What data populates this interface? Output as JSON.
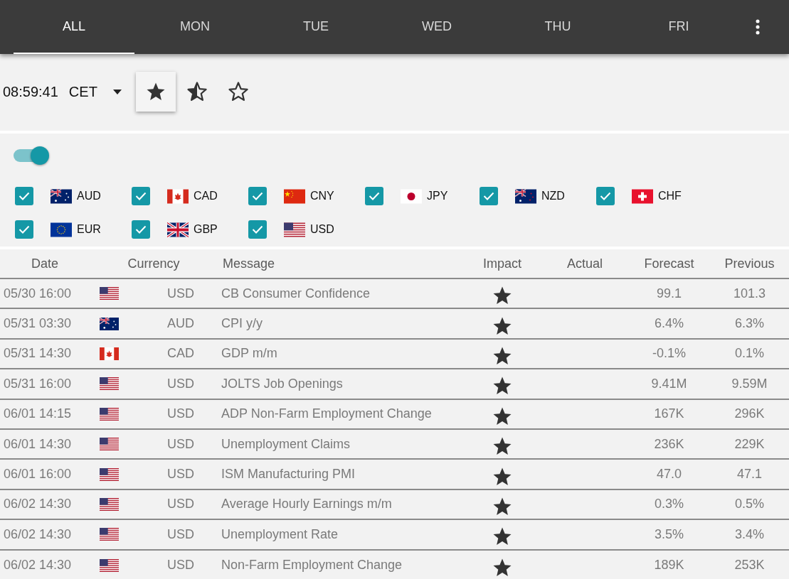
{
  "tabs": [
    {
      "label": "ALL",
      "selected": true
    },
    {
      "label": "MON",
      "selected": false
    },
    {
      "label": "TUE",
      "selected": false
    },
    {
      "label": "WED",
      "selected": false
    },
    {
      "label": "THU",
      "selected": false
    },
    {
      "label": "FRI",
      "selected": false
    }
  ],
  "clock": {
    "time": "08:59:41",
    "timezone": "CET"
  },
  "impact_filters": [
    {
      "kind": "full",
      "selected": true
    },
    {
      "kind": "half",
      "selected": false
    },
    {
      "kind": "empty",
      "selected": false
    }
  ],
  "toggle": {
    "on": true
  },
  "currencies": [
    {
      "code": "AUD",
      "kind": "au",
      "checked": true
    },
    {
      "code": "CAD",
      "kind": "ca",
      "checked": true
    },
    {
      "code": "CNY",
      "kind": "cn",
      "checked": true
    },
    {
      "code": "JPY",
      "kind": "jp",
      "checked": true
    },
    {
      "code": "NZD",
      "kind": "nz",
      "checked": true
    },
    {
      "code": "CHF",
      "kind": "ch",
      "checked": true
    },
    {
      "code": "EUR",
      "kind": "eu",
      "checked": true
    },
    {
      "code": "GBP",
      "kind": "gb",
      "checked": true
    },
    {
      "code": "USD",
      "kind": "us",
      "checked": true
    }
  ],
  "table": {
    "columns": [
      "Date",
      "Currency",
      "Message",
      "Impact",
      "Actual",
      "Forecast",
      "Previous"
    ],
    "rows": [
      {
        "date": "05/30 16:00",
        "kind": "us",
        "currency": "USD",
        "message": "CB Consumer Confidence",
        "forecast": "99.1",
        "previous": "101.3"
      },
      {
        "date": "05/31 03:30",
        "kind": "au",
        "currency": "AUD",
        "message": "CPI y/y",
        "forecast": "6.4%",
        "previous": "6.3%"
      },
      {
        "date": "05/31 14:30",
        "kind": "ca",
        "currency": "CAD",
        "message": "GDP m/m",
        "forecast": "-0.1%",
        "previous": "0.1%"
      },
      {
        "date": "05/31 16:00",
        "kind": "us",
        "currency": "USD",
        "message": "JOLTS Job Openings",
        "forecast": "9.41M",
        "previous": "9.59M"
      },
      {
        "date": "06/01 14:15",
        "kind": "us",
        "currency": "USD",
        "message": "ADP Non-Farm Employment Change",
        "forecast": "167K",
        "previous": "296K"
      },
      {
        "date": "06/01 14:30",
        "kind": "us",
        "currency": "USD",
        "message": "Unemployment Claims",
        "forecast": "236K",
        "previous": "229K"
      },
      {
        "date": "06/01 16:00",
        "kind": "us",
        "currency": "USD",
        "message": "ISM Manufacturing PMI",
        "forecast": "47.0",
        "previous": "47.1"
      },
      {
        "date": "06/02 14:30",
        "kind": "us",
        "currency": "USD",
        "message": "Average Hourly Earnings m/m",
        "forecast": "0.3%",
        "previous": "0.5%"
      },
      {
        "date": "06/02 14:30",
        "kind": "us",
        "currency": "USD",
        "message": "Unemployment Rate",
        "forecast": "3.5%",
        "previous": "3.4%"
      },
      {
        "date": "06/02 14:30",
        "kind": "us",
        "currency": "USD",
        "message": "Non-Farm Employment Change",
        "forecast": "189K",
        "previous": "253K"
      }
    ]
  }
}
